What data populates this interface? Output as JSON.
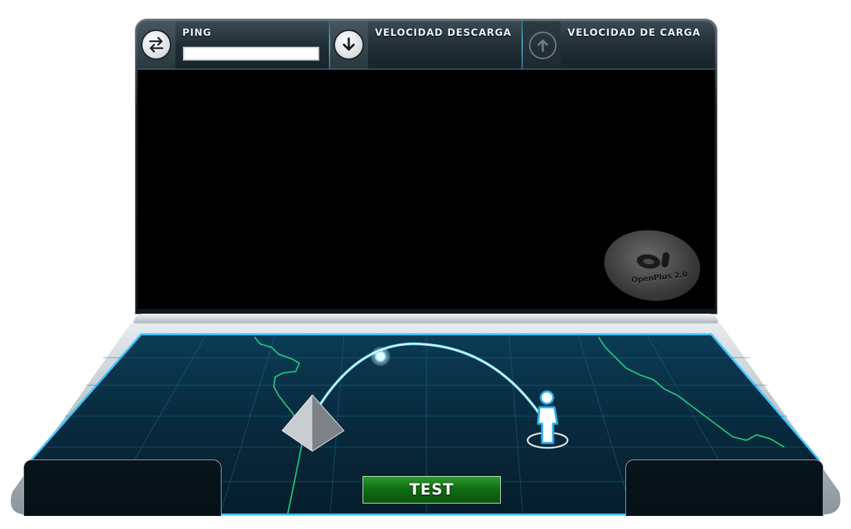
{
  "header": {
    "ping": {
      "label": "PING",
      "value": ""
    },
    "download": {
      "label": "VELOCIDAD DESCARGA"
    },
    "upload": {
      "label": "VELOCIDAD DE CARGA"
    }
  },
  "icons": {
    "ping": "swap-arrows-icon",
    "download": "arrow-down-icon",
    "upload": "arrow-up-icon",
    "server": "pyramid-server-icon",
    "user": "user-figure-icon"
  },
  "logo": {
    "text": "OpenPlus 2.0"
  },
  "test_button": {
    "label": "TEST"
  },
  "colors": {
    "accent": "#39c6ff",
    "map_line": "#1fc47a",
    "test_button": "#167a19"
  }
}
